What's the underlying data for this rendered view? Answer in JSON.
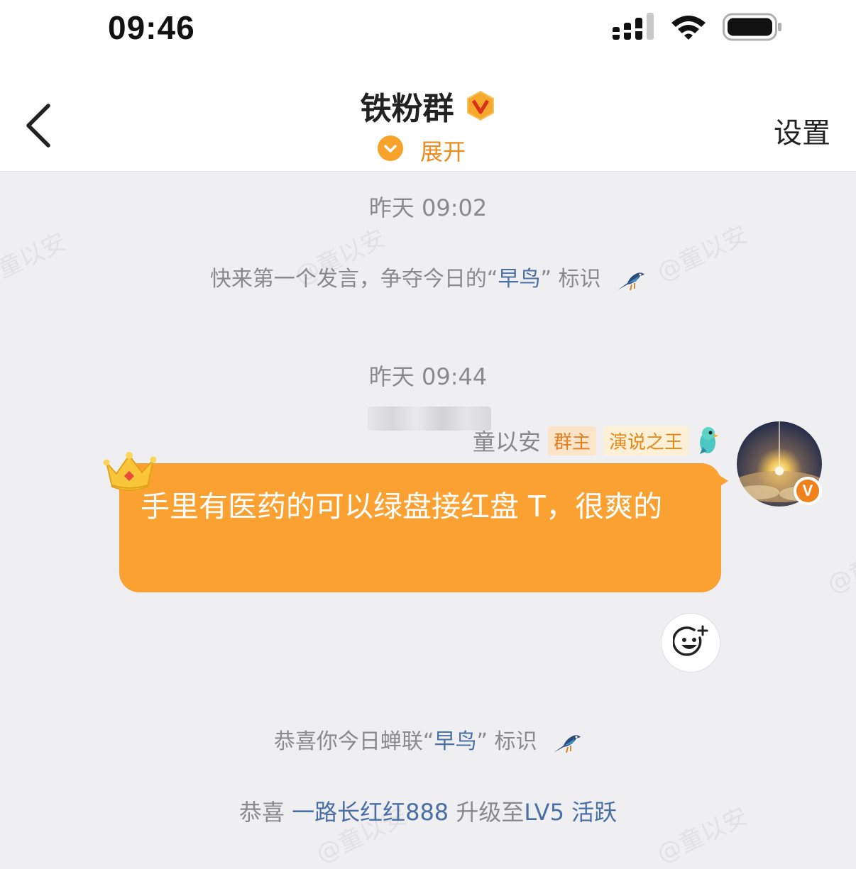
{
  "status_bar": {
    "time": "09:46",
    "signal_icon": "signal-icon",
    "wifi_icon": "wifi-icon",
    "battery_icon": "battery-icon"
  },
  "nav": {
    "back_icon": "chevron-left-icon",
    "title": "铁粉群",
    "title_badge_icon": "verified-v-badge-icon",
    "expand_label": "展开",
    "expand_icon": "chevron-down-circle-icon",
    "settings_label": "设置"
  },
  "watermark_text": "@童以安",
  "messages": {
    "timestamp1": "昨天 09:02",
    "system1": {
      "pre": "快来第一个发言，争夺今日的",
      "q_open": "“",
      "highlight": "早鸟",
      "q_close": "”",
      "post": " 标识",
      "icon": "bird-icon"
    },
    "timestamp2": "昨天 09:44",
    "chat": {
      "sender_name": "童以安",
      "tag_owner": "群主",
      "tag_king": "演说之王",
      "sender_badge_icon": "parrot-badge-icon",
      "avatar_icon": "avatar-sunrise",
      "text": "手里有医药的可以绿盘接红盘 T，很爽的",
      "crown_icon": "crown-icon",
      "verify_badge": "V"
    },
    "react_icon": "add-emoji-icon",
    "system2": {
      "pre": "恭喜你今日蝉联",
      "q_open": "“",
      "highlight": "早鸟",
      "q_close": "”",
      "post": " 标识",
      "icon": "bird-icon"
    },
    "system3": {
      "pre": "恭喜 ",
      "highlight": "一路长红红888",
      "mid": " 升级至",
      "level": "LV5 活跃"
    }
  },
  "colors": {
    "accent_orange": "#fba132",
    "link_blue": "#4a6fa5",
    "background": "#efeff1"
  }
}
